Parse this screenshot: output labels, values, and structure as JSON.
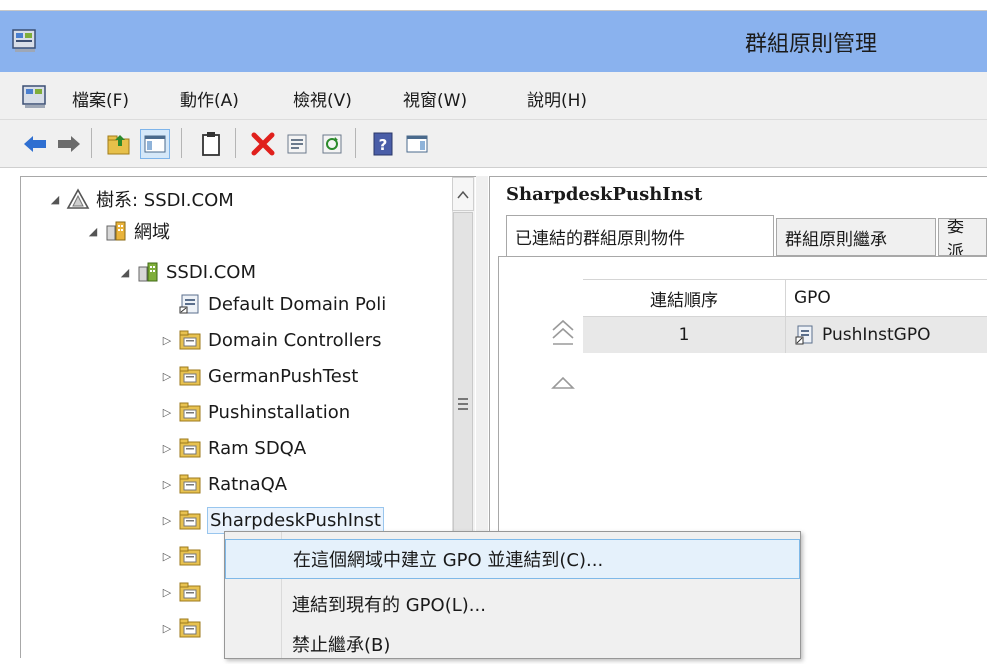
{
  "window": {
    "title": "群組原則管理"
  },
  "menu": {
    "items": [
      "檔案(F)",
      "動作(A)",
      "檢視(V)",
      "視窗(W)",
      "說明(H)"
    ]
  },
  "toolbar": {
    "icons": [
      "back-arrow-icon",
      "forward-arrow-icon",
      "up-folder-icon",
      "show-hide-tree-icon",
      "clipboard-icon",
      "delete-icon",
      "properties-icon",
      "refresh-icon",
      "help-icon",
      "console-icon"
    ]
  },
  "tree": {
    "forest": "樹系: SSDI.COM",
    "domains": "網域",
    "domain": "SSDI.COM",
    "items": [
      {
        "label": "Default Domain Poli",
        "type": "gpo-link"
      },
      {
        "label": "Domain Controllers",
        "type": "ou"
      },
      {
        "label": "GermanPushTest",
        "type": "ou"
      },
      {
        "label": "Pushinstallation",
        "type": "ou"
      },
      {
        "label": "Ram SDQA",
        "type": "ou"
      },
      {
        "label": "RatnaQA",
        "type": "ou"
      },
      {
        "label": "SharpdeskPushInst",
        "type": "ou",
        "selected": true
      },
      {
        "label": "",
        "type": "ou"
      },
      {
        "label": "",
        "type": "ou"
      },
      {
        "label": "",
        "type": "ou"
      }
    ]
  },
  "details": {
    "title": "SharpdeskPushInst",
    "tabs": [
      "已連結的群組原則物件",
      "群組原則繼承",
      "委派"
    ],
    "columns": [
      "連結順序",
      "GPO"
    ],
    "rows": [
      {
        "order": "1",
        "gpo": "PushInstGPO"
      }
    ]
  },
  "context_menu": {
    "items": [
      {
        "label": "在這個網域中建立 GPO 並連結到(C)...",
        "highlighted": true
      },
      {
        "label": "連結到現有的 GPO(L)..."
      },
      {
        "label": "禁止繼承(B)"
      }
    ]
  },
  "colors": {
    "titlebar": "#8ab2ee",
    "highlight_bg": "#e5f1fb",
    "highlight_border": "#7fb9e8"
  }
}
